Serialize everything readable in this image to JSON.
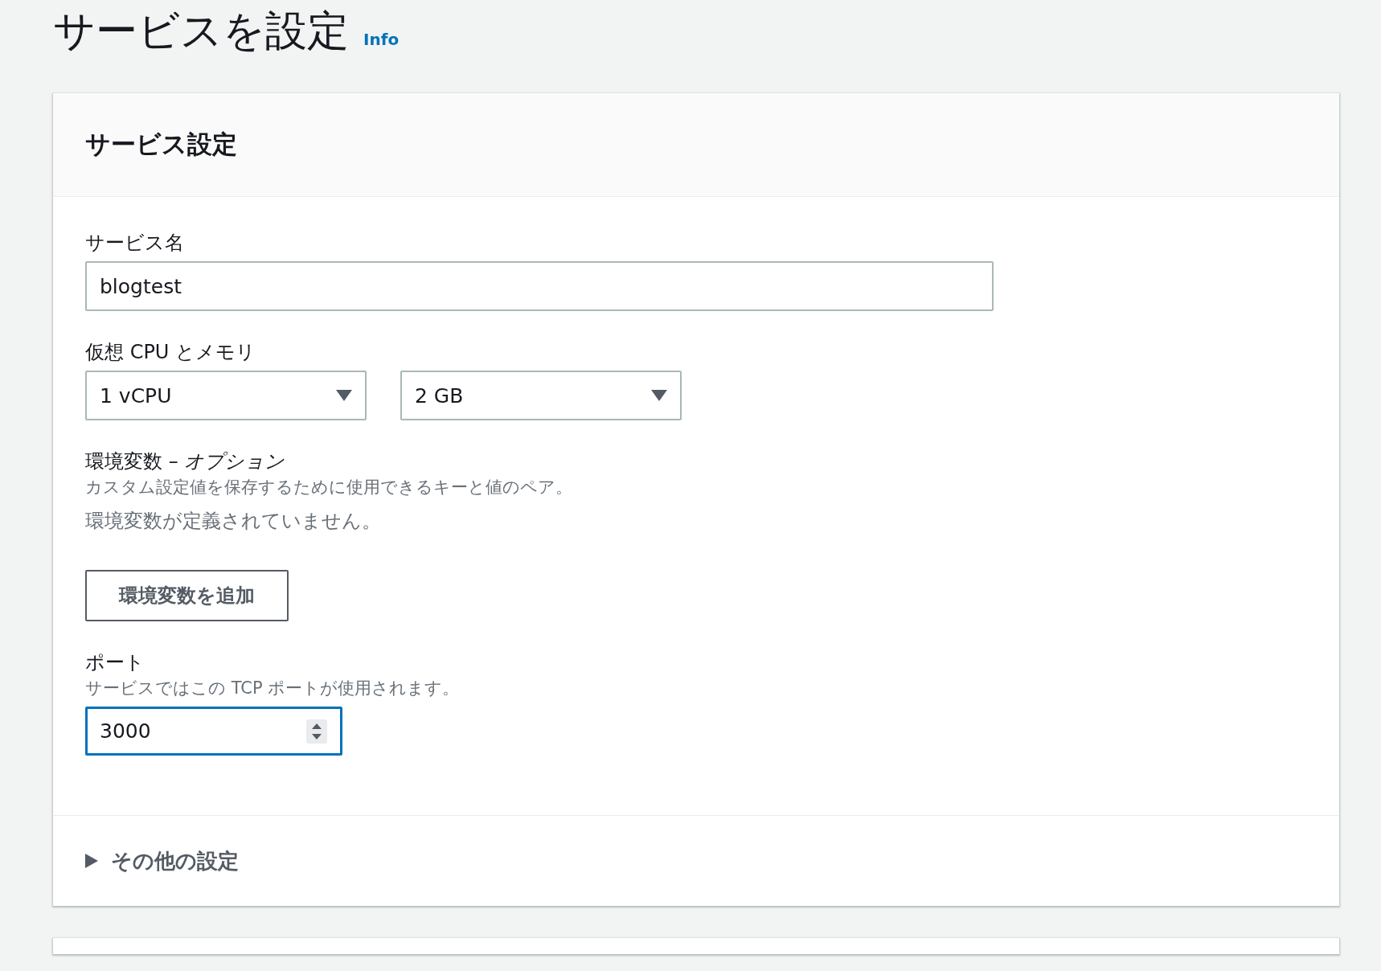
{
  "page": {
    "title": "サービスを設定",
    "info_link": "Info"
  },
  "card": {
    "title": "サービス設定",
    "fields": [
      {
        "kind": "text",
        "label": "サービス名",
        "value": "blogtest",
        "focused": false
      },
      {
        "kind": "selects",
        "label": "仮想 CPU とメモリ",
        "options": [
          "1 vCPU",
          "2 GB"
        ]
      },
      {
        "kind": "env",
        "label": "環境変数 – *オプション*",
        "description": "カスタム設定値を保存するために使用できるキーと値のペア。",
        "empty_text": "環境変数が定義されていません。",
        "button": "環境変数を追加"
      },
      {
        "kind": "number",
        "label": "ポート",
        "description": "サービスではこの TCP ポートが使用されます。",
        "value": "3000",
        "focused": true
      }
    ],
    "expander": {
      "label": "その他の設定",
      "expanded": false
    }
  }
}
